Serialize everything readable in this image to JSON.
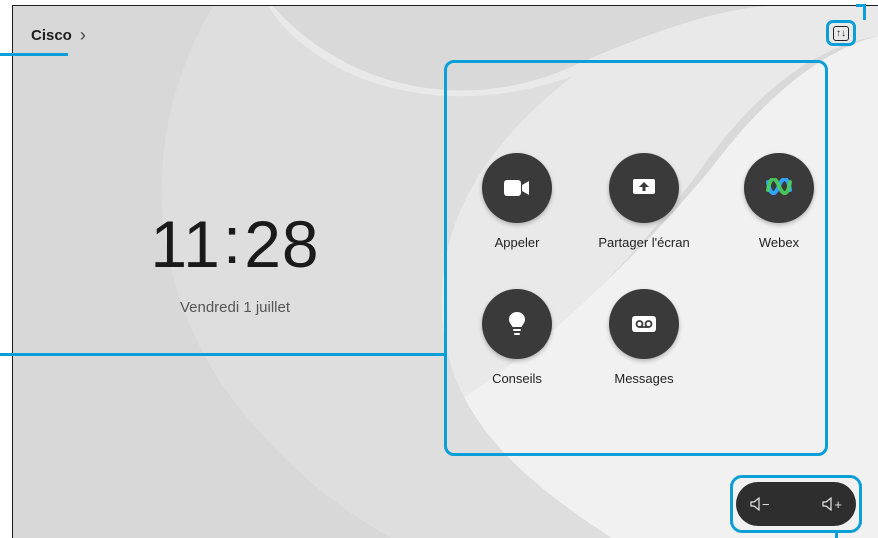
{
  "header": {
    "brand": "Cisco",
    "chevron": "›"
  },
  "clock": {
    "hours": "11",
    "separator": ":",
    "minutes": "28"
  },
  "date": "Vendredi 1 juillet",
  "layout_button": {
    "glyph": "↑↓",
    "icon": "layout-toggle-icon"
  },
  "apps": [
    {
      "label": "Appeler",
      "icon": "video-camera-icon"
    },
    {
      "label": "Partager l'écran",
      "icon": "share-screen-icon"
    },
    {
      "label": "Webex",
      "icon": "webex-logo-icon"
    },
    {
      "label": "Conseils",
      "icon": "lightbulb-icon"
    },
    {
      "label": "Messages",
      "icon": "voicemail-icon"
    }
  ],
  "volume": {
    "down": "−",
    "up": "+"
  },
  "colors": {
    "accent": "#0b9fd8",
    "button": "#3a3a3a",
    "background": "#dcdcdc"
  }
}
